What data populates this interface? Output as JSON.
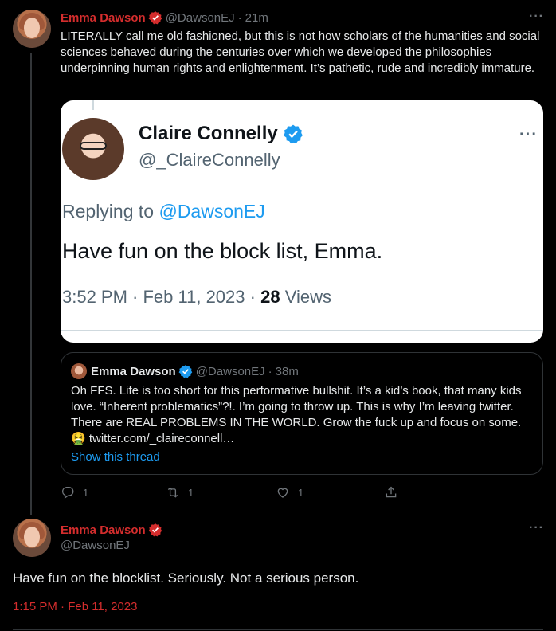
{
  "colors": {
    "background": "#000000",
    "name_red": "#d42d2d",
    "text": "#e7e9ea",
    "muted": "#71767b",
    "link_blue": "#1d9bf0",
    "verified_red": "#d42d2d",
    "verified_blue": "#1d9bf0"
  },
  "tweet1": {
    "name": "Emma Dawson",
    "handle": "@DawsonEJ",
    "dot": "·",
    "time": "21m",
    "more": "···",
    "text": "LITERALLY call me old fashioned, but this is not how scholars of the humanities and social sciences behaved during the centuries over which we developed the philosophies underpinning human rights and enlightenment. It’s pathetic, rude and incredibly immature.",
    "image": {
      "name": "Claire Connelly",
      "handle": "@_ClaireConnelly",
      "more": "···",
      "replying_label": "Replying to",
      "replying_handle": "@DawsonEJ",
      "body": "Have fun on the block list, Emma.",
      "meta_time": "3:52 PM · Feb 11, 2023 ·",
      "meta_views_count": "28",
      "meta_views_label": "Views"
    },
    "quote": {
      "name": "Emma Dawson",
      "handle": "@DawsonEJ",
      "dot": "·",
      "time": "38m",
      "text": "Oh FFS. Life is too short for this performative bullshit. It’s a kid’s book, that many kids love. “Inherent problematics”?!. I’m going to throw up. This is why I’m leaving twitter. There are REAL PROBLEMS IN THE WORLD. Grow the fuck up and focus on some. 🤮 twitter.com/_claireconnell…",
      "show_thread": "Show this thread"
    },
    "actions": {
      "reply_count": "1",
      "retweet_count": "1",
      "like_count": "1"
    }
  },
  "tweet2": {
    "name": "Emma Dawson",
    "handle": "@DawsonEJ",
    "more": "···",
    "text": "Have fun on the blocklist. Seriously. Not a serious person.",
    "timestamp": "1:15 PM · Feb 11, 2023"
  }
}
